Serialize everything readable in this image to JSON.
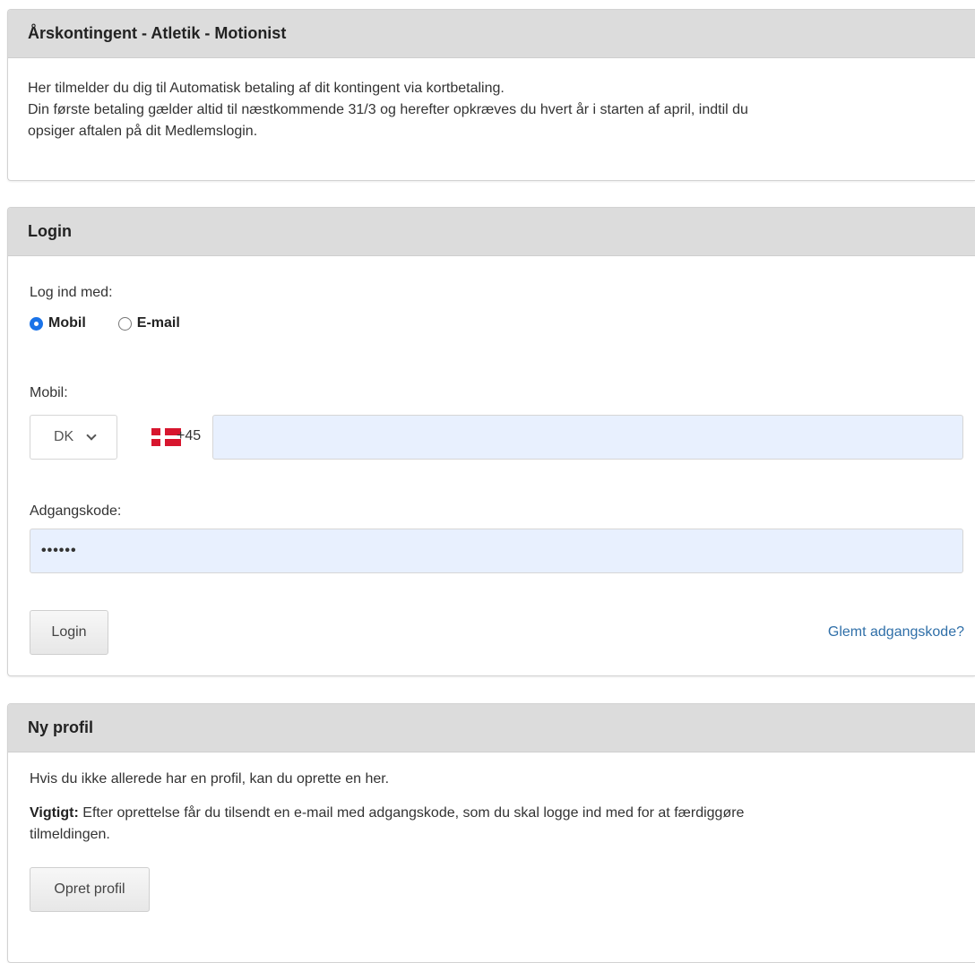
{
  "intro": {
    "title": "Årskontingent - Atletik - Motionist",
    "line1": "Her tilmelder du dig til Automatisk betaling af dit kontingent via kortbetaling.",
    "line2": "Din første betaling gælder altid til næstkommende 31/3 og herefter opkræves du hvert år i starten af april, indtil du",
    "line3": "opsiger aftalen på dit Medlemslogin."
  },
  "login": {
    "title": "Login",
    "login_with_label": "Log ind med:",
    "option_mobile": "Mobil",
    "option_email": "E-mail",
    "selected_option": "Mobil",
    "mobile_label": "Mobil:",
    "country_code": "DK",
    "dial_code": "+45",
    "mobile_value": "",
    "password_label": "Adgangskode:",
    "password_value": "••••••",
    "login_button": "Login",
    "forgot_link": "Glemt adgangskode?"
  },
  "signup": {
    "title": "Ny profil",
    "text": "Hvis du ikke allerede har en profil, kan du oprette en her.",
    "important_label": "Vigtigt:",
    "important_line1": "Efter oprettelse får du tilsendt en e-mail med adgangskode, som du skal logge ind med for at færdiggøre",
    "important_line2": "tilmeldingen.",
    "create_button": "Opret profil"
  },
  "colors": {
    "heading_bg": "#dcdcdc",
    "input_autofill_bg": "#e8f0fe",
    "link": "#2f6fa8",
    "radio_checked": "#1a73e8"
  }
}
